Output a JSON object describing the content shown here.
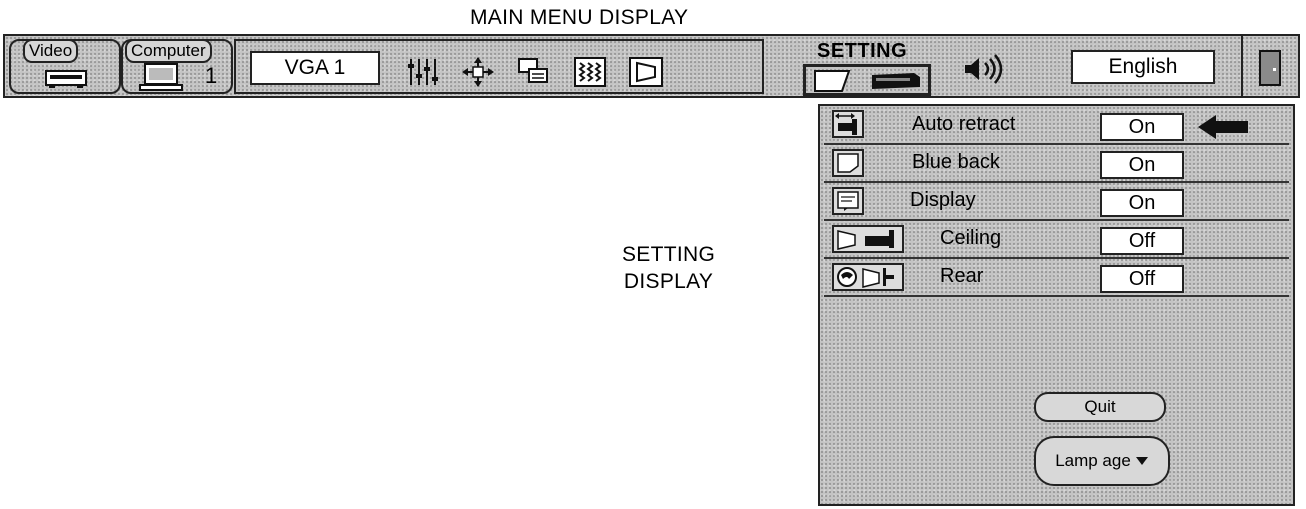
{
  "captions": {
    "main_menu": "MAIN MENU DISPLAY",
    "setting_line1": "SETTING",
    "setting_line2": "DISPLAY"
  },
  "menubar": {
    "tabs": [
      {
        "label": "Video",
        "icon": "vcr-icon"
      },
      {
        "label": "Computer",
        "icon": "monitor-icon",
        "number": "1"
      }
    ],
    "source_value": "VGA 1",
    "tool_icons": [
      "image-adjust-icon",
      "position-icon",
      "pc-adjust-icon",
      "image-level-icon",
      "screen-icon"
    ],
    "setting_title": "SETTING",
    "setting_icons": [
      "screen-icon",
      "projector-icon"
    ],
    "sound_icon": "speaker-icon",
    "language": "English",
    "exit_icon": "exit-door-icon"
  },
  "setting_panel": {
    "rows": [
      {
        "label": "Auto retract",
        "value": "On",
        "icon": "auto-retract-icon",
        "selected": true
      },
      {
        "label": "Blue back",
        "value": "On",
        "icon": "blue-back-icon"
      },
      {
        "label": "Display",
        "value": "On",
        "icon": "display-icon"
      },
      {
        "label": "Ceiling",
        "value": "Off",
        "icon": "ceiling-icon"
      },
      {
        "label": "Rear",
        "value": "Off",
        "icon": "rear-icon"
      }
    ],
    "quit_label": "Quit",
    "lamp_label": "Lamp age"
  }
}
